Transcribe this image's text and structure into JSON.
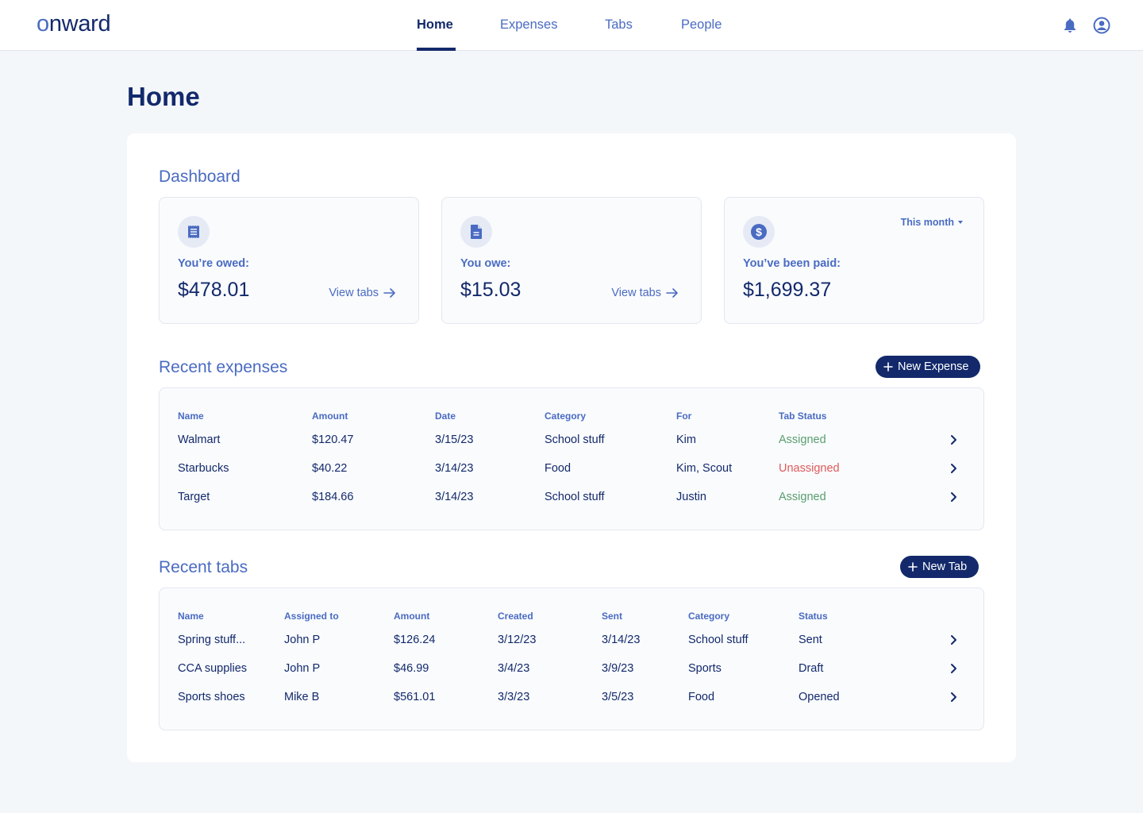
{
  "app": {
    "logo": "onward",
    "nav": [
      {
        "label": "Home",
        "active": true
      },
      {
        "label": "Expenses",
        "active": false
      },
      {
        "label": "Tabs",
        "active": false
      },
      {
        "label": "People",
        "active": false
      }
    ],
    "icons": {
      "notifications": "bell-icon",
      "account": "user-circle-icon"
    }
  },
  "page": {
    "title": "Home"
  },
  "dashboard": {
    "title": "Dashboard",
    "cards": [
      {
        "icon": "receipt-icon",
        "label": "You’re owed:",
        "value": "$478.01",
        "link": "View tabs"
      },
      {
        "icon": "document-icon",
        "label": "You owe:",
        "value": "$15.03",
        "link": "View tabs"
      },
      {
        "icon": "dollar-circle-icon",
        "label": "You’ve been paid:",
        "value": "$1,699.37",
        "period": "This month"
      }
    ]
  },
  "expenses": {
    "title": "Recent expenses",
    "new_button": "New Expense",
    "columns": [
      "Name",
      "Amount",
      "Date",
      "Category",
      "For",
      "Tab Status"
    ],
    "rows": [
      {
        "name": "Walmart",
        "amount": "$120.47",
        "date": "3/15/23",
        "category": "School stuff",
        "for": "Kim",
        "status": "Assigned"
      },
      {
        "name": "Starbucks",
        "amount": "$40.22",
        "date": "3/14/23",
        "category": "Food",
        "for": "Kim, Scout",
        "status": "Unassigned"
      },
      {
        "name": "Target",
        "amount": "$184.66",
        "date": "3/14/23",
        "category": "School stuff",
        "for": "Justin",
        "status": "Assigned"
      }
    ]
  },
  "tabs": {
    "title": "Recent tabs",
    "new_button": "New Tab",
    "columns": [
      "Name",
      "Assigned to",
      "Amount",
      "Created",
      "Sent",
      "Category",
      "Status"
    ],
    "rows": [
      {
        "name": "Spring stuff...",
        "assigned_to": "John P",
        "amount": "$126.24",
        "created": "3/12/23",
        "sent": "3/14/23",
        "category": "School stuff",
        "status": "Sent"
      },
      {
        "name": "CCA supplies",
        "assigned_to": "John P",
        "amount": "$46.99",
        "created": "3/4/23",
        "sent": "3/9/23",
        "category": "Sports",
        "status": "Draft"
      },
      {
        "name": "Sports shoes",
        "assigned_to": "Mike B",
        "amount": "$561.01",
        "created": "3/3/23",
        "sent": "3/5/23",
        "category": "Food",
        "status": "Opened"
      }
    ]
  },
  "colors": {
    "brand_dark": "#13296b",
    "brand_accent": "#4a6bc2",
    "status_assigned": "#5a9e6e",
    "status_unassigned": "#e05a5a",
    "background": "#f4f7fa"
  }
}
